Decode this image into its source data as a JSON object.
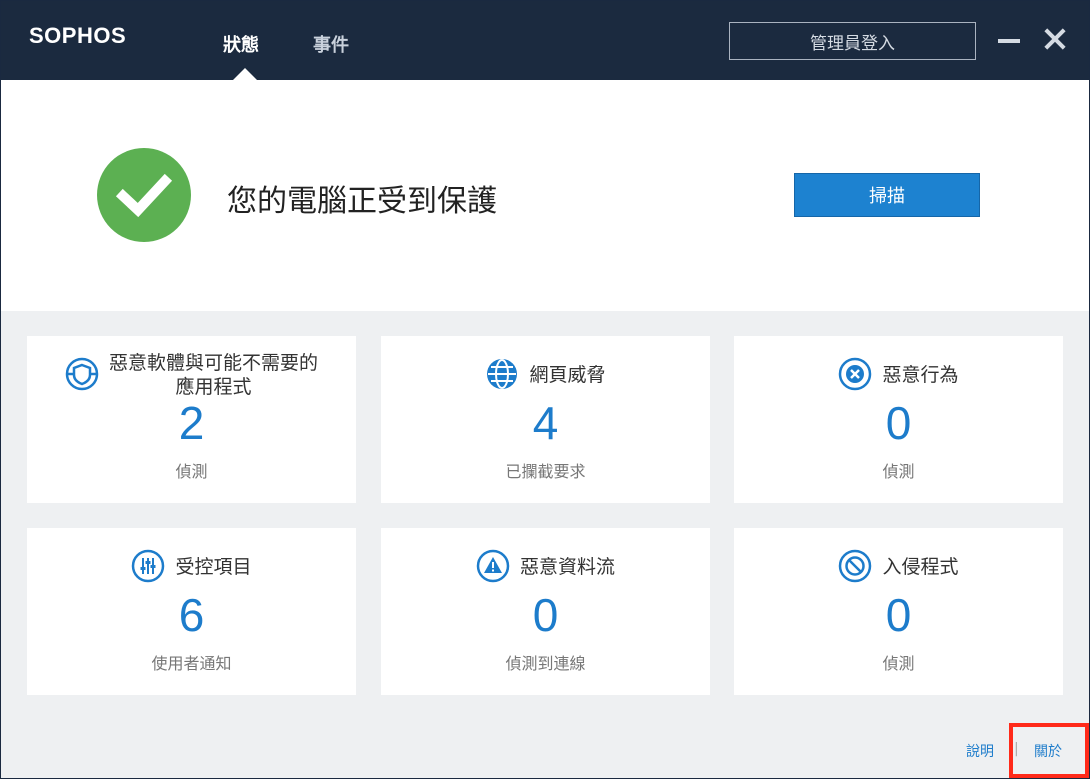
{
  "app": {
    "logo": "SOPHOS"
  },
  "tabs": [
    {
      "label": "狀態",
      "active": true
    },
    {
      "label": "事件",
      "active": false
    }
  ],
  "header": {
    "admin_login_label": "管理員登入"
  },
  "status": {
    "message": "您的電腦正受到保護",
    "state_color": "#5cb052",
    "scan_label": "掃描"
  },
  "cards": [
    {
      "icon": "shield-target-icon",
      "title": "惡意軟體與可能不需要的應用程式",
      "title_line1": "惡意軟體與可能不需要的",
      "title_line2": "應用程式",
      "value": "2",
      "sub": "偵測"
    },
    {
      "icon": "globe-icon",
      "title": "網頁威脅",
      "value": "4",
      "sub": "已攔截要求"
    },
    {
      "icon": "close-circle-icon",
      "title": "惡意行為",
      "value": "0",
      "sub": "偵測"
    },
    {
      "icon": "sliders-icon",
      "title": "受控項目",
      "value": "6",
      "sub": "使用者通知"
    },
    {
      "icon": "warning-triangle-icon",
      "title": "惡意資料流",
      "value": "0",
      "sub": "偵測到連線"
    },
    {
      "icon": "blocked-icon",
      "title": "入侵程式",
      "value": "0",
      "sub": "偵測"
    }
  ],
  "footer": {
    "help_label": "說明",
    "separator": "|",
    "about_label": "關於"
  },
  "colors": {
    "accent": "#1d7ccb",
    "titlebar": "#1b2a3f",
    "highlight": "#ff2a1a"
  }
}
